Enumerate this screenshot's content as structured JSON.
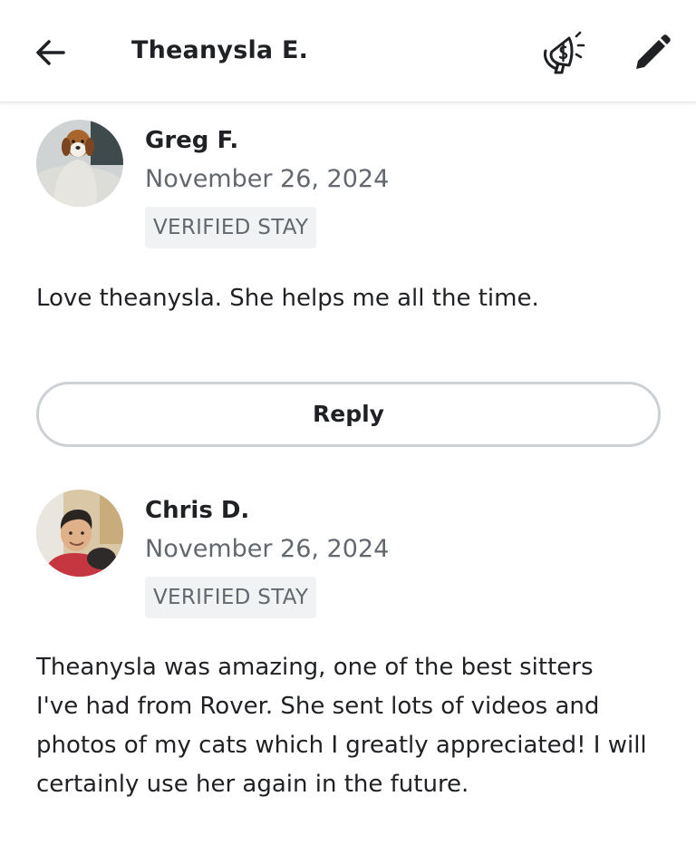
{
  "header": {
    "title": "Theanysla E.",
    "back_icon": "arrow-left-icon",
    "promo_icon": "megaphone-dollar-icon",
    "edit_icon": "pencil-icon"
  },
  "reviews": [
    {
      "name": "Greg F.",
      "date": "November 26, 2024",
      "badge": "VERIFIED STAY",
      "text": "Love theanysla.  She helps me all the time.",
      "reply_label": "Reply"
    },
    {
      "name": "Chris D.",
      "date": "November 26, 2024",
      "badge": "VERIFIED STAY",
      "text": "Theanysla was amazing, one of the best sitters\nI've had from Rover.  She sent lots of videos and\nphotos of my cats which I greatly appreciated!  I will\ncertainly use her again in the future."
    }
  ],
  "colors": {
    "text": "#1f2124",
    "muted": "#62686e",
    "badge_bg": "#f1f2f4",
    "reply_border": "#cdd1d6"
  }
}
